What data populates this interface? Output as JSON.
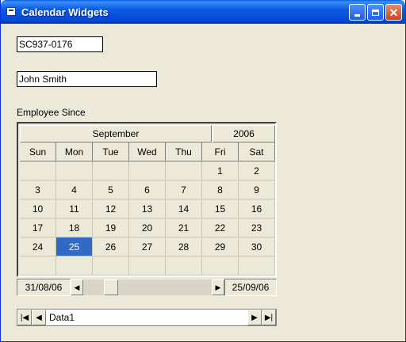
{
  "window": {
    "title": "Calendar Widgets"
  },
  "form": {
    "id_value": "SC937-0176",
    "name_value": "John Smith",
    "employee_since_label": "Employee Since"
  },
  "calendar": {
    "month": "September",
    "year": "2006",
    "weekdays": [
      "Sun",
      "Mon",
      "Tue",
      "Wed",
      "Thu",
      "Fri",
      "Sat"
    ],
    "weeks": [
      [
        "",
        "",
        "",
        "",
        "",
        "1",
        "2"
      ],
      [
        "3",
        "4",
        "5",
        "6",
        "7",
        "8",
        "9"
      ],
      [
        "10",
        "11",
        "12",
        "13",
        "14",
        "15",
        "16"
      ],
      [
        "17",
        "18",
        "19",
        "20",
        "21",
        "22",
        "23"
      ],
      [
        "24",
        "25",
        "26",
        "27",
        "28",
        "29",
        "30"
      ],
      [
        "",
        "",
        "",
        "",
        "",
        "",
        ""
      ]
    ],
    "selected_day": "25",
    "selected_color": "#316ac5"
  },
  "range": {
    "start_date": "31/08/06",
    "end_date": "25/09/06"
  },
  "data_control": {
    "caption": "Data1"
  }
}
